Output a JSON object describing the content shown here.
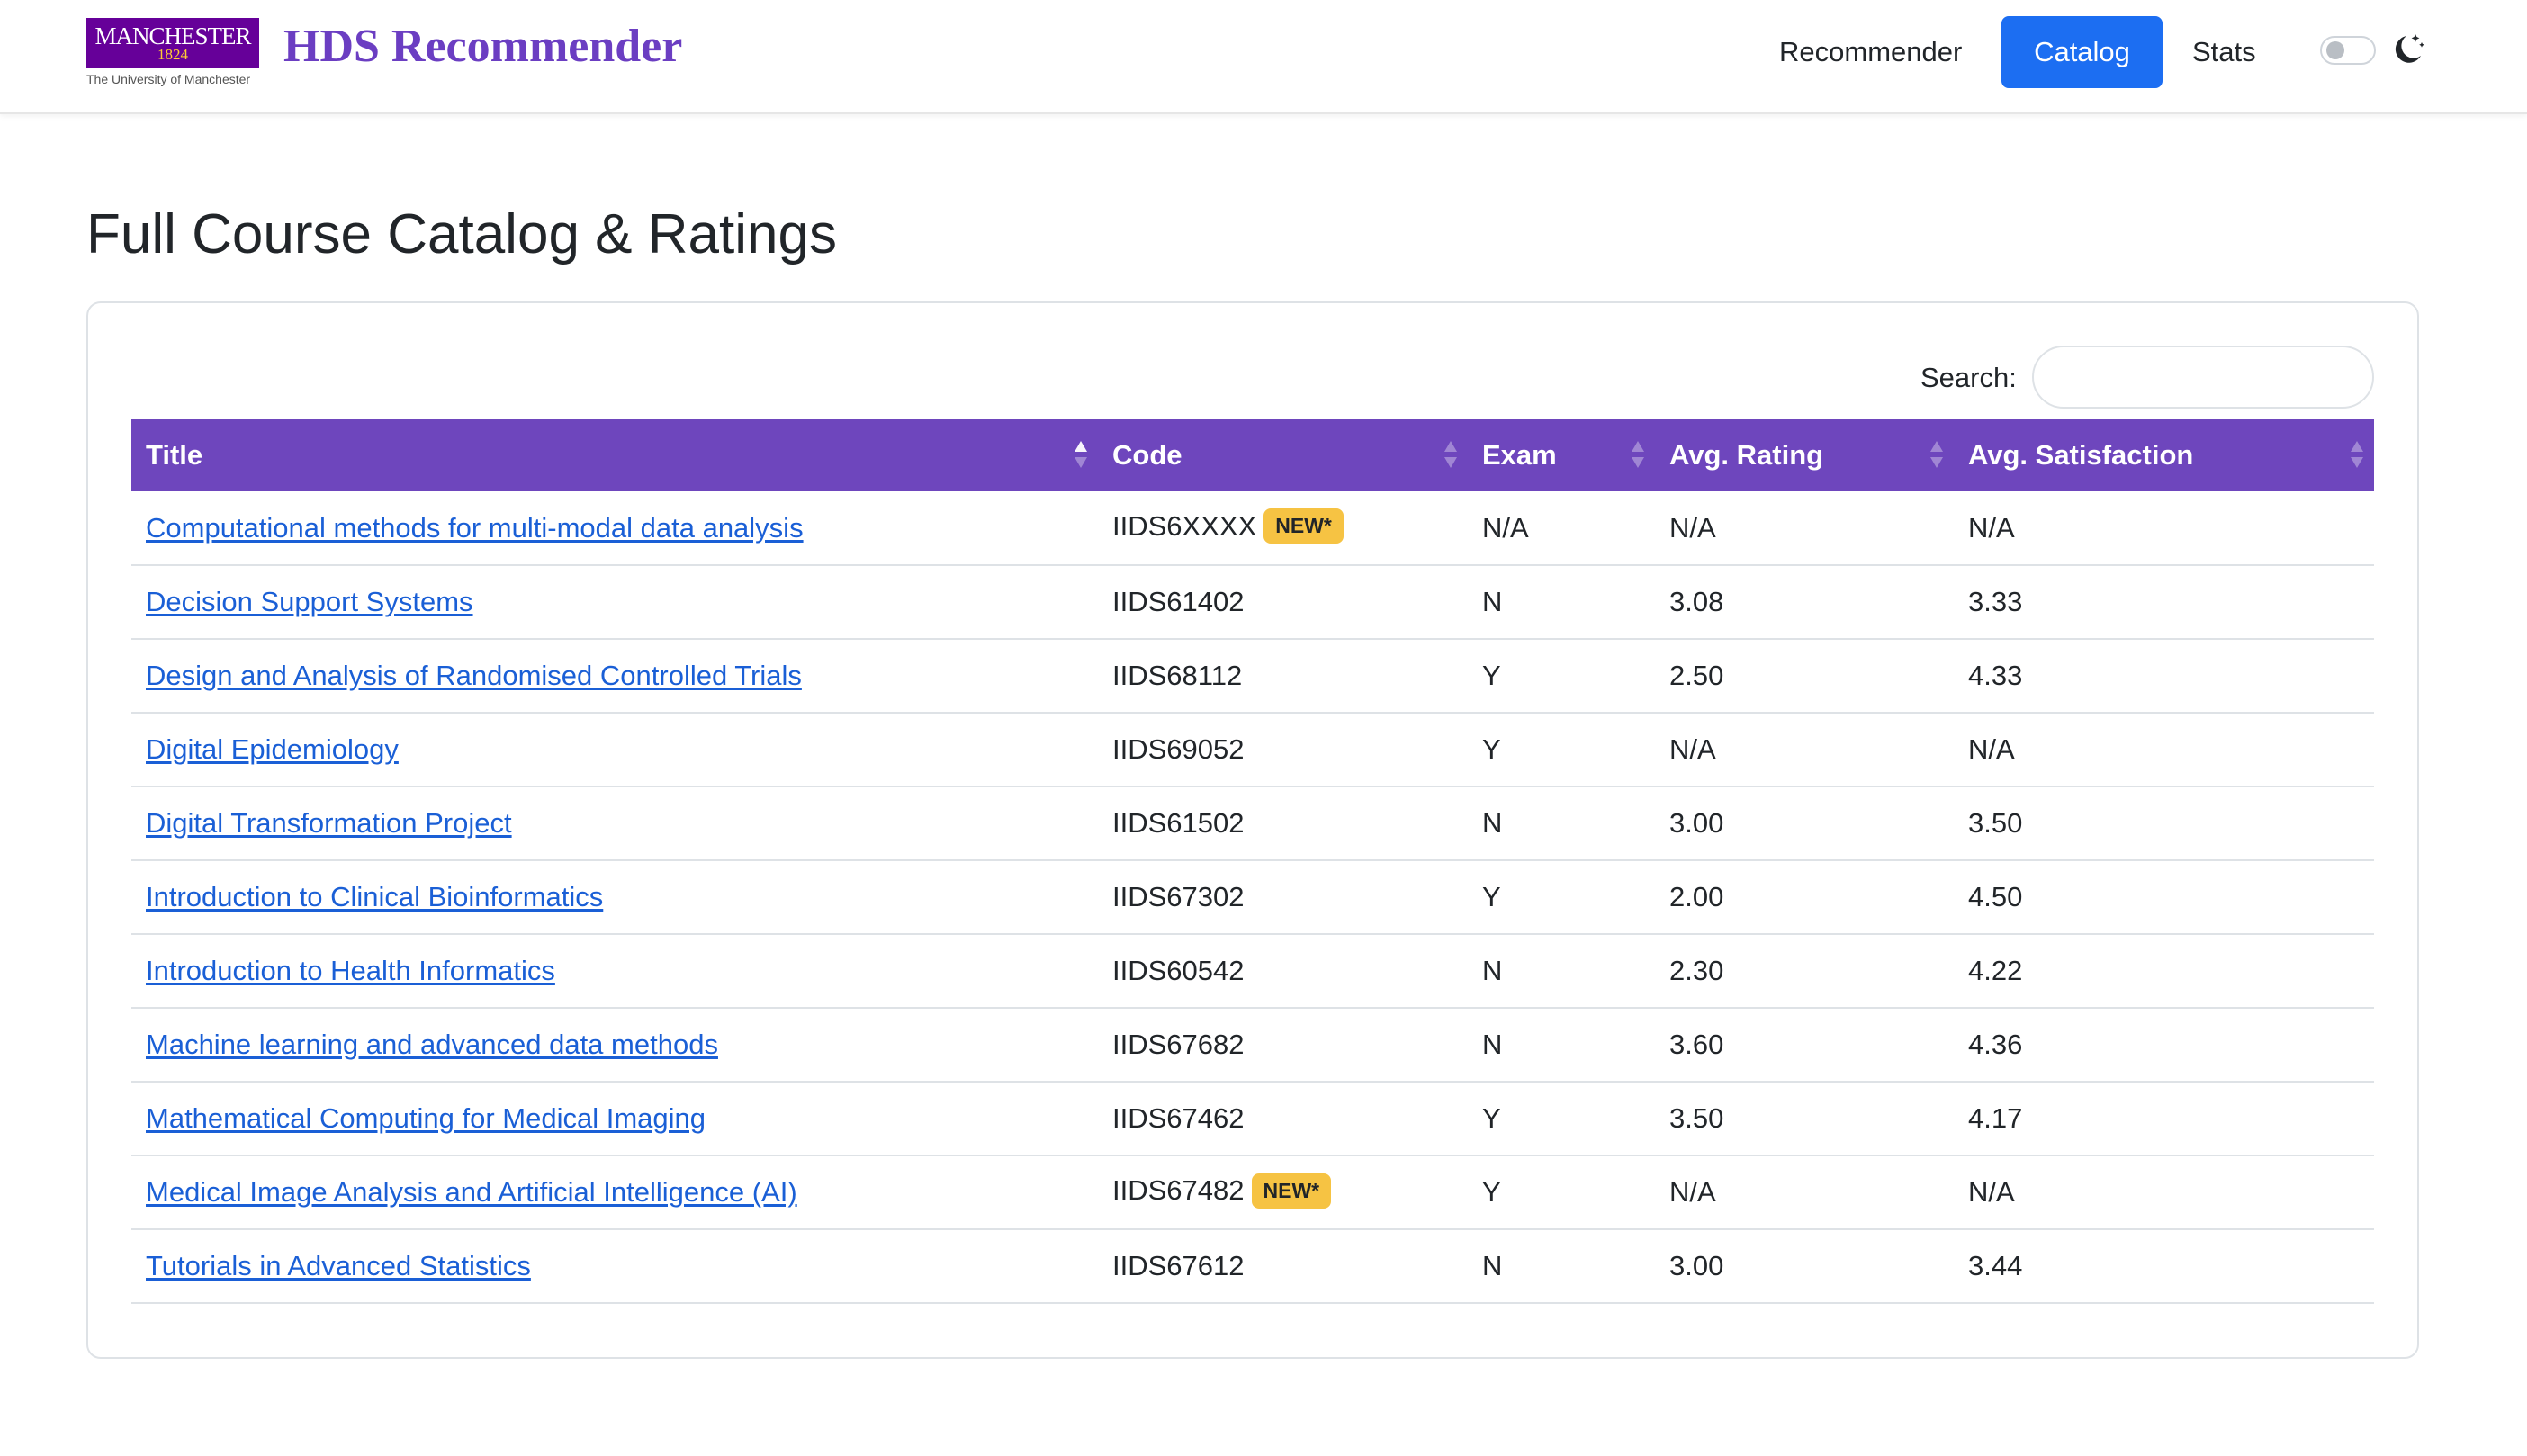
{
  "brand": {
    "logo_text": "MANCHESTER",
    "logo_year": "1824",
    "logo_subtitle": "The University of Manchester",
    "title": "HDS Recommender"
  },
  "nav": {
    "items": [
      {
        "label": "Recommender",
        "active": false
      },
      {
        "label": "Catalog",
        "active": true
      },
      {
        "label": "Stats",
        "active": false
      }
    ],
    "theme_toggle": {
      "state": "off",
      "icon": "moon-icon"
    }
  },
  "colors": {
    "brand_purple": "#6b3ec2",
    "header_purple": "#6e46bd",
    "active_blue": "#1c6ef2",
    "link_blue": "#1a5fd6",
    "badge_yellow": "#f6c343"
  },
  "page": {
    "title": "Full Course Catalog & Ratings"
  },
  "search": {
    "label": "Search:",
    "value": "",
    "placeholder": ""
  },
  "table": {
    "sorted_by": "Title",
    "sort_direction": "asc",
    "columns": [
      "Title",
      "Code",
      "Exam",
      "Avg. Rating",
      "Avg. Satisfaction"
    ],
    "rows": [
      {
        "title": "Computational methods for multi-modal data analysis ",
        "code": "IIDS6XXXX",
        "badge": "NEW*",
        "exam": "N/A",
        "rating": "N/A",
        "satisfaction": "N/A"
      },
      {
        "title": "Decision Support Systems",
        "code": "IIDS61402",
        "badge": "",
        "exam": "N",
        "rating": "3.08",
        "satisfaction": "3.33"
      },
      {
        "title": "Design and Analysis of Randomised Controlled Trials",
        "code": "IIDS68112",
        "badge": "",
        "exam": "Y",
        "rating": "2.50",
        "satisfaction": "4.33"
      },
      {
        "title": "Digital Epidemiology",
        "code": "IIDS69052",
        "badge": "",
        "exam": "Y",
        "rating": "N/A",
        "satisfaction": "N/A"
      },
      {
        "title": "Digital Transformation Project",
        "code": "IIDS61502",
        "badge": "",
        "exam": "N",
        "rating": "3.00",
        "satisfaction": "3.50"
      },
      {
        "title": "Introduction to Clinical Bioinformatics",
        "code": "IIDS67302",
        "badge": "",
        "exam": "Y",
        "rating": "2.00",
        "satisfaction": "4.50"
      },
      {
        "title": "Introduction to Health Informatics",
        "code": "IIDS60542",
        "badge": "",
        "exam": "N",
        "rating": "2.30",
        "satisfaction": "4.22"
      },
      {
        "title": "Machine learning and advanced data methods",
        "code": "IIDS67682",
        "badge": "",
        "exam": "N",
        "rating": "3.60",
        "satisfaction": "4.36"
      },
      {
        "title": "Mathematical Computing for Medical Imaging",
        "code": "IIDS67462",
        "badge": "",
        "exam": "Y",
        "rating": "3.50",
        "satisfaction": "4.17"
      },
      {
        "title": "Medical Image Analysis and Artificial Intelligence (AI)",
        "code": "IIDS67482",
        "badge": "NEW*",
        "exam": "Y",
        "rating": "N/A",
        "satisfaction": "N/A"
      },
      {
        "title": "Tutorials in Advanced Statistics ",
        "code": "IIDS67612",
        "badge": "",
        "exam": "N",
        "rating": "3.00",
        "satisfaction": "3.44"
      }
    ]
  }
}
